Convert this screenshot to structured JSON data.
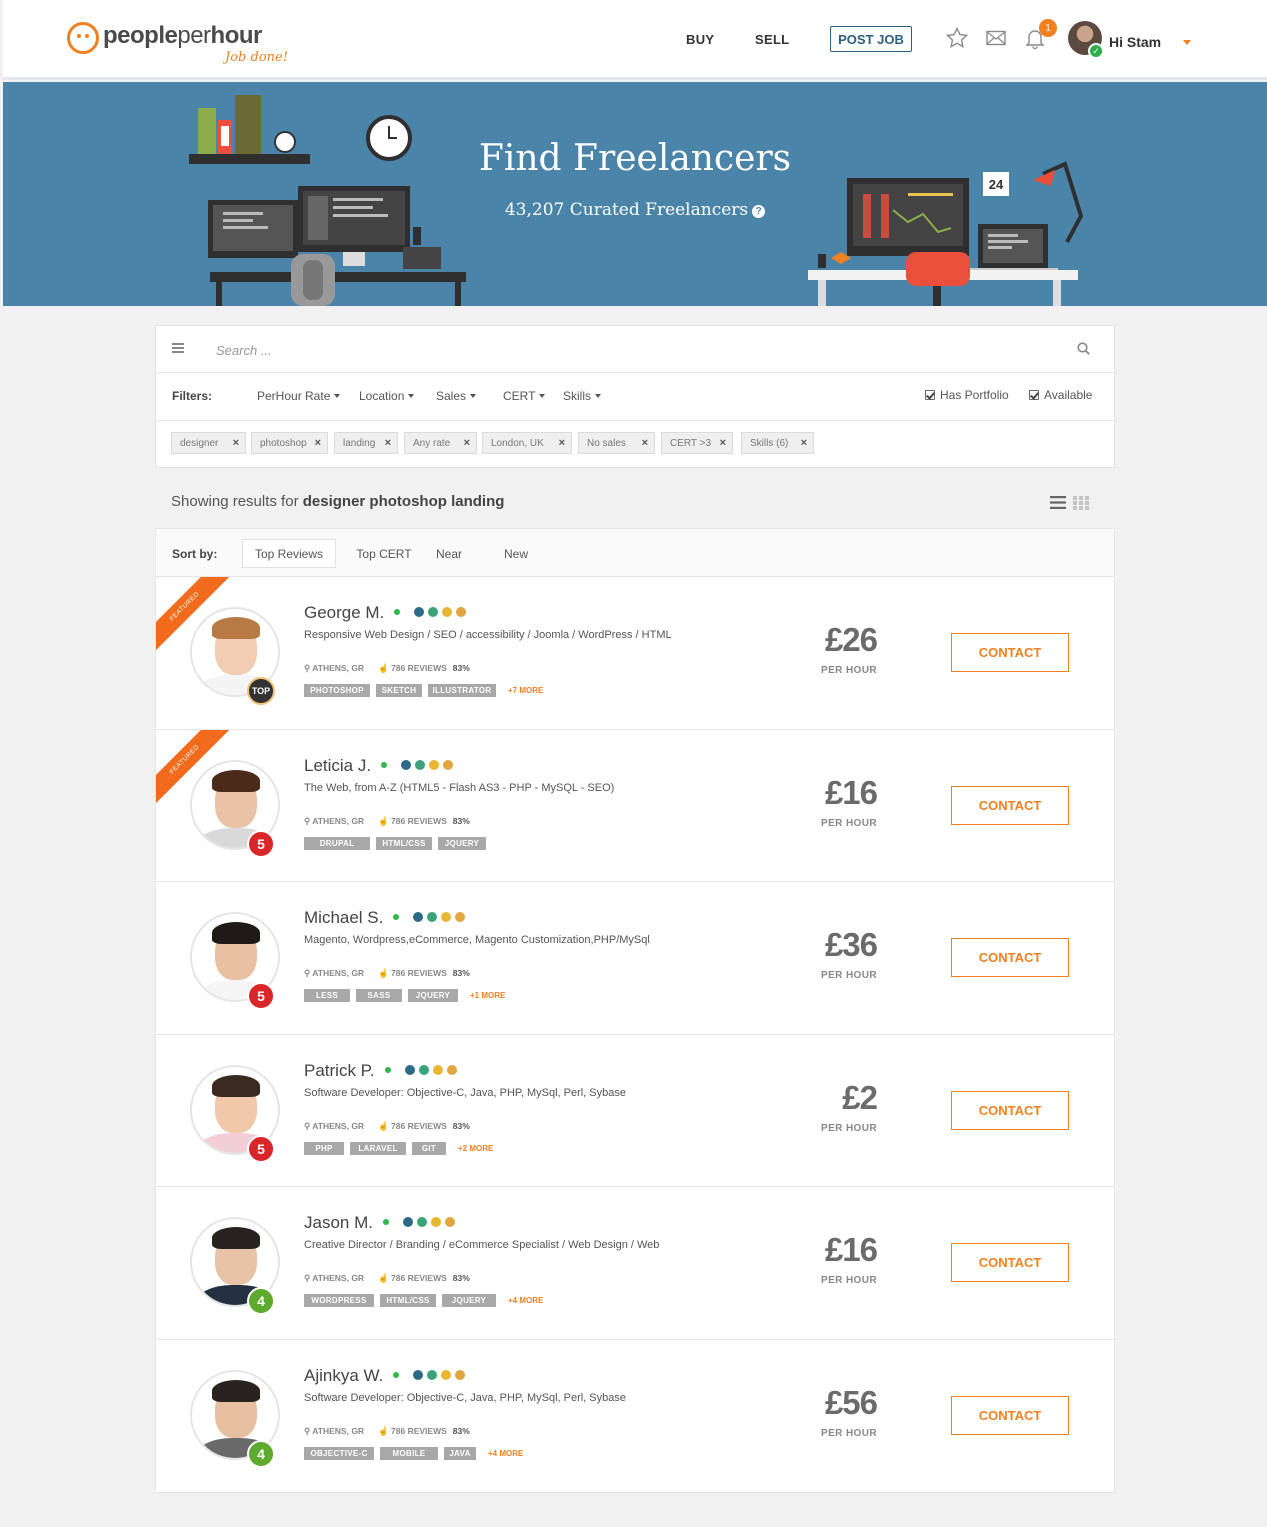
{
  "header": {
    "logo_bold": "people",
    "logo_light": "per",
    "logo_bold2": "hour",
    "logo_tagline": "Job done!",
    "nav_buy": "BUY",
    "nav_sell": "SELL",
    "post_job": "POST JOB",
    "notification_count": "1",
    "user_greeting": "Hi Stam"
  },
  "hero": {
    "title": "Find Freelancers",
    "subtitle": "43,207 Curated Freelancers",
    "help_glyph": "?"
  },
  "search": {
    "placeholder": "Search ...",
    "value": ""
  },
  "filters": {
    "label": "Filters:",
    "dropdowns": [
      "PerHour Rate",
      "Location",
      "Sales",
      "CERT",
      "Skills"
    ],
    "checkboxes": [
      {
        "label": "Has Portfolio",
        "checked": true
      },
      {
        "label": "Available",
        "checked": true
      }
    ],
    "chips": [
      "designer",
      "photoshop",
      "landing",
      "Any rate",
      "London, UK",
      "No sales",
      "CERT >3",
      "Skills (6)"
    ]
  },
  "results": {
    "prefix": "Showing results for",
    "query": "designer photoshop landing"
  },
  "sort": {
    "label": "Sort by:",
    "tabs": [
      "Top Reviews",
      "Top CERT",
      "Near",
      "New"
    ],
    "active": "Top Reviews"
  },
  "freelancers": [
    {
      "name": "George M.",
      "headline": "Responsive Web Design / SEO / accessibility / Joomla / WordPress / HTML",
      "location": "ATHENS, GR",
      "reviews": "786 REVIEWS",
      "pct": "83%",
      "skills": [
        "PHOTOSHOP",
        "SKETCH",
        "ILLUSTRATOR"
      ],
      "more": "+7 MORE",
      "rate": "£26",
      "per": "PER HOUR",
      "contact": "CONTACT",
      "featured": "FEATURED",
      "badge": "TOP"
    },
    {
      "name": "Leticia J.",
      "headline": "The Web, from A-Z (HTML5 - Flash AS3 - PHP - MySQL - SEO)",
      "location": "ATHENS, GR",
      "reviews": "786 REVIEWS",
      "pct": "83%",
      "skills": [
        "DRUPAL",
        "HTML/CSS",
        "JQUERY"
      ],
      "more": "",
      "rate": "£16",
      "per": "PER HOUR",
      "contact": "CONTACT",
      "featured": "FEATURED",
      "badge": "5"
    },
    {
      "name": "Michael S.",
      "headline": "Magento, Wordpress,eCommerce, Magento Customization,PHP/MySql",
      "location": "ATHENS, GR",
      "reviews": "786 REVIEWS",
      "pct": "83%",
      "skills": [
        "LESS",
        "SASS",
        "JQUERY"
      ],
      "more": "+1 MORE",
      "rate": "£36",
      "per": "PER HOUR",
      "contact": "CONTACT",
      "featured": "",
      "badge": "5"
    },
    {
      "name": "Patrick P.",
      "headline": "Software Developer: Objective-C, Java, PHP, MySql, Perl, Sybase",
      "location": "ATHENS, GR",
      "reviews": "786 REVIEWS",
      "pct": "83%",
      "skills": [
        "PHP",
        "LARAVEL",
        "GIT"
      ],
      "more": "+2 MORE",
      "rate": "£2",
      "per": "PER HOUR",
      "contact": "CONTACT",
      "featured": "",
      "badge": "5"
    },
    {
      "name": "Jason M.",
      "headline": "Creative Director / Branding / eCommerce Specialist / Web Design / Web",
      "location": "ATHENS, GR",
      "reviews": "786 REVIEWS",
      "pct": "83%",
      "skills": [
        "WORDPRESS",
        "HTML/CSS",
        "JQUERY"
      ],
      "more": "+4 MORE",
      "rate": "£16",
      "per": "PER HOUR",
      "contact": "CONTACT",
      "featured": "",
      "badge": "4"
    },
    {
      "name": "Ajinkya W.",
      "headline": "Software Developer: Objective-C, Java, PHP, MySql, Perl, Sybase",
      "location": "ATHENS, GR",
      "reviews": "786 REVIEWS",
      "pct": "83%",
      "skills": [
        "OBJECTIVE-C",
        "MOBILE",
        "JAVA"
      ],
      "more": "+4 MORE",
      "rate": "£56",
      "per": "PER HOUR",
      "contact": "CONTACT",
      "featured": "",
      "badge": "4"
    }
  ],
  "colors": {
    "brand_orange": "#f08020",
    "hero_blue": "#4a85a9",
    "navy": "#2d5f80"
  }
}
